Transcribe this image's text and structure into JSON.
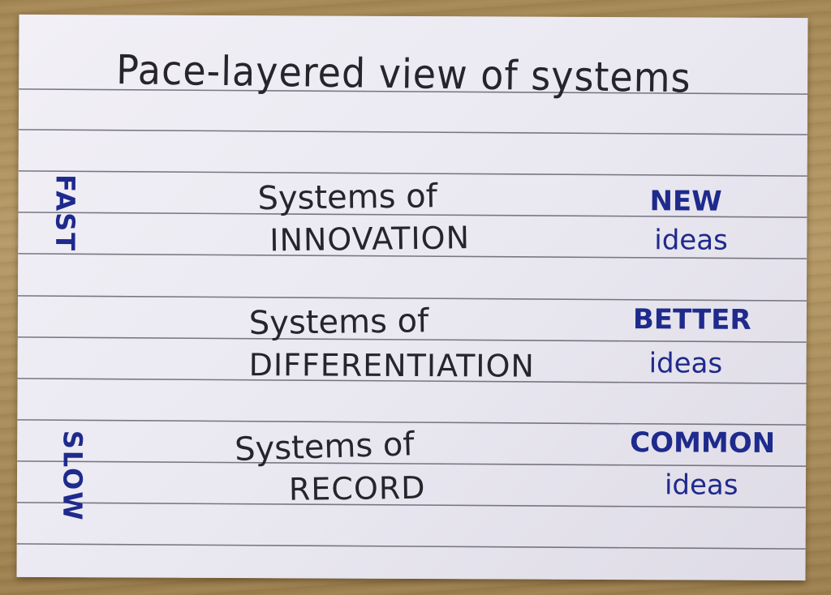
{
  "card": {
    "title": "Pace-layered view of systems",
    "speed_fast": "FAST",
    "speed_slow": "SLOW",
    "rows": [
      {
        "line1": "Systems of",
        "line2": "INNOVATION",
        "idea_word": "NEW",
        "idea_sub": "ideas"
      },
      {
        "line1": "Systems of",
        "line2": "DIFFERENTIATION",
        "idea_word": "BETTER",
        "idea_sub": "ideas"
      },
      {
        "line1": "Systems of",
        "line2": "RECORD",
        "idea_word": "COMMON",
        "idea_sub": "ideas"
      }
    ]
  },
  "colors": {
    "ink_black": "#26252b",
    "ink_blue": "#1e2a8c",
    "card": "#ecebf2",
    "table": "#a48755"
  }
}
